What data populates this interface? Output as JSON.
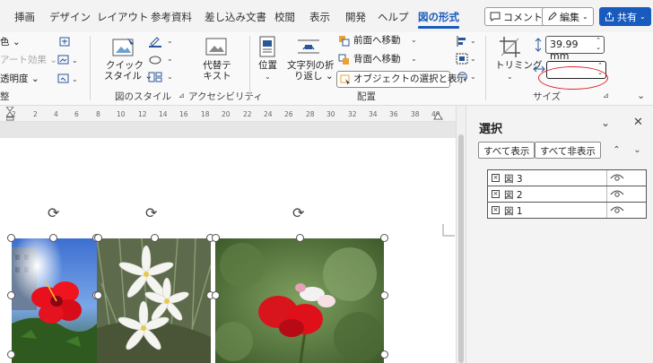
{
  "tabs": [
    "挿画",
    "デザイン",
    "レイアウト",
    "参考資料",
    "差し込み文書",
    "校閲",
    "表示",
    "開発",
    "ヘルプ",
    "図の形式"
  ],
  "active_tab": "図の形式",
  "top_buttons": {
    "comment": "コメント",
    "edit": "編集",
    "share": "共有"
  },
  "ribbon": {
    "adjust": {
      "color": "色",
      "art_effect": "アート効果",
      "transparency": "透明度",
      "group_label_partial": "整"
    },
    "style": {
      "quick_style_line1": "クイック",
      "quick_style_line2": "スタイル",
      "group_label": "図のスタイル"
    },
    "accessibility": {
      "alt_text_line1": "代替テ",
      "alt_text_line2": "キスト",
      "group_label": "アクセシビリティ"
    },
    "arrange": {
      "position": "位置",
      "wrap_line1": "文字列の折",
      "wrap_line2": "り返し",
      "bring_forward": "前面へ移動",
      "send_backward": "背面へ移動",
      "selection_pane": "オブジェクトの選択と表示",
      "group_label": "配置"
    },
    "size": {
      "crop": "トリミング",
      "height_value": "39.99 mm",
      "width_value": "",
      "group_label": "サイズ"
    }
  },
  "ruler": {
    "ticks": [
      "2",
      "2",
      "4",
      "6",
      "8",
      "10",
      "12",
      "14",
      "16",
      "18",
      "20",
      "22",
      "24",
      "26",
      "28",
      "30",
      "32",
      "34",
      "36",
      "38",
      "40"
    ]
  },
  "selection_pane": {
    "title": "選択",
    "show_all": "すべて表示",
    "hide_all": "すべて非表示",
    "objects": [
      {
        "name": "図 3"
      },
      {
        "name": "図 2"
      },
      {
        "name": "図 1"
      }
    ]
  },
  "colors": {
    "accent": "#185abd",
    "highlight": "#e0242d"
  }
}
